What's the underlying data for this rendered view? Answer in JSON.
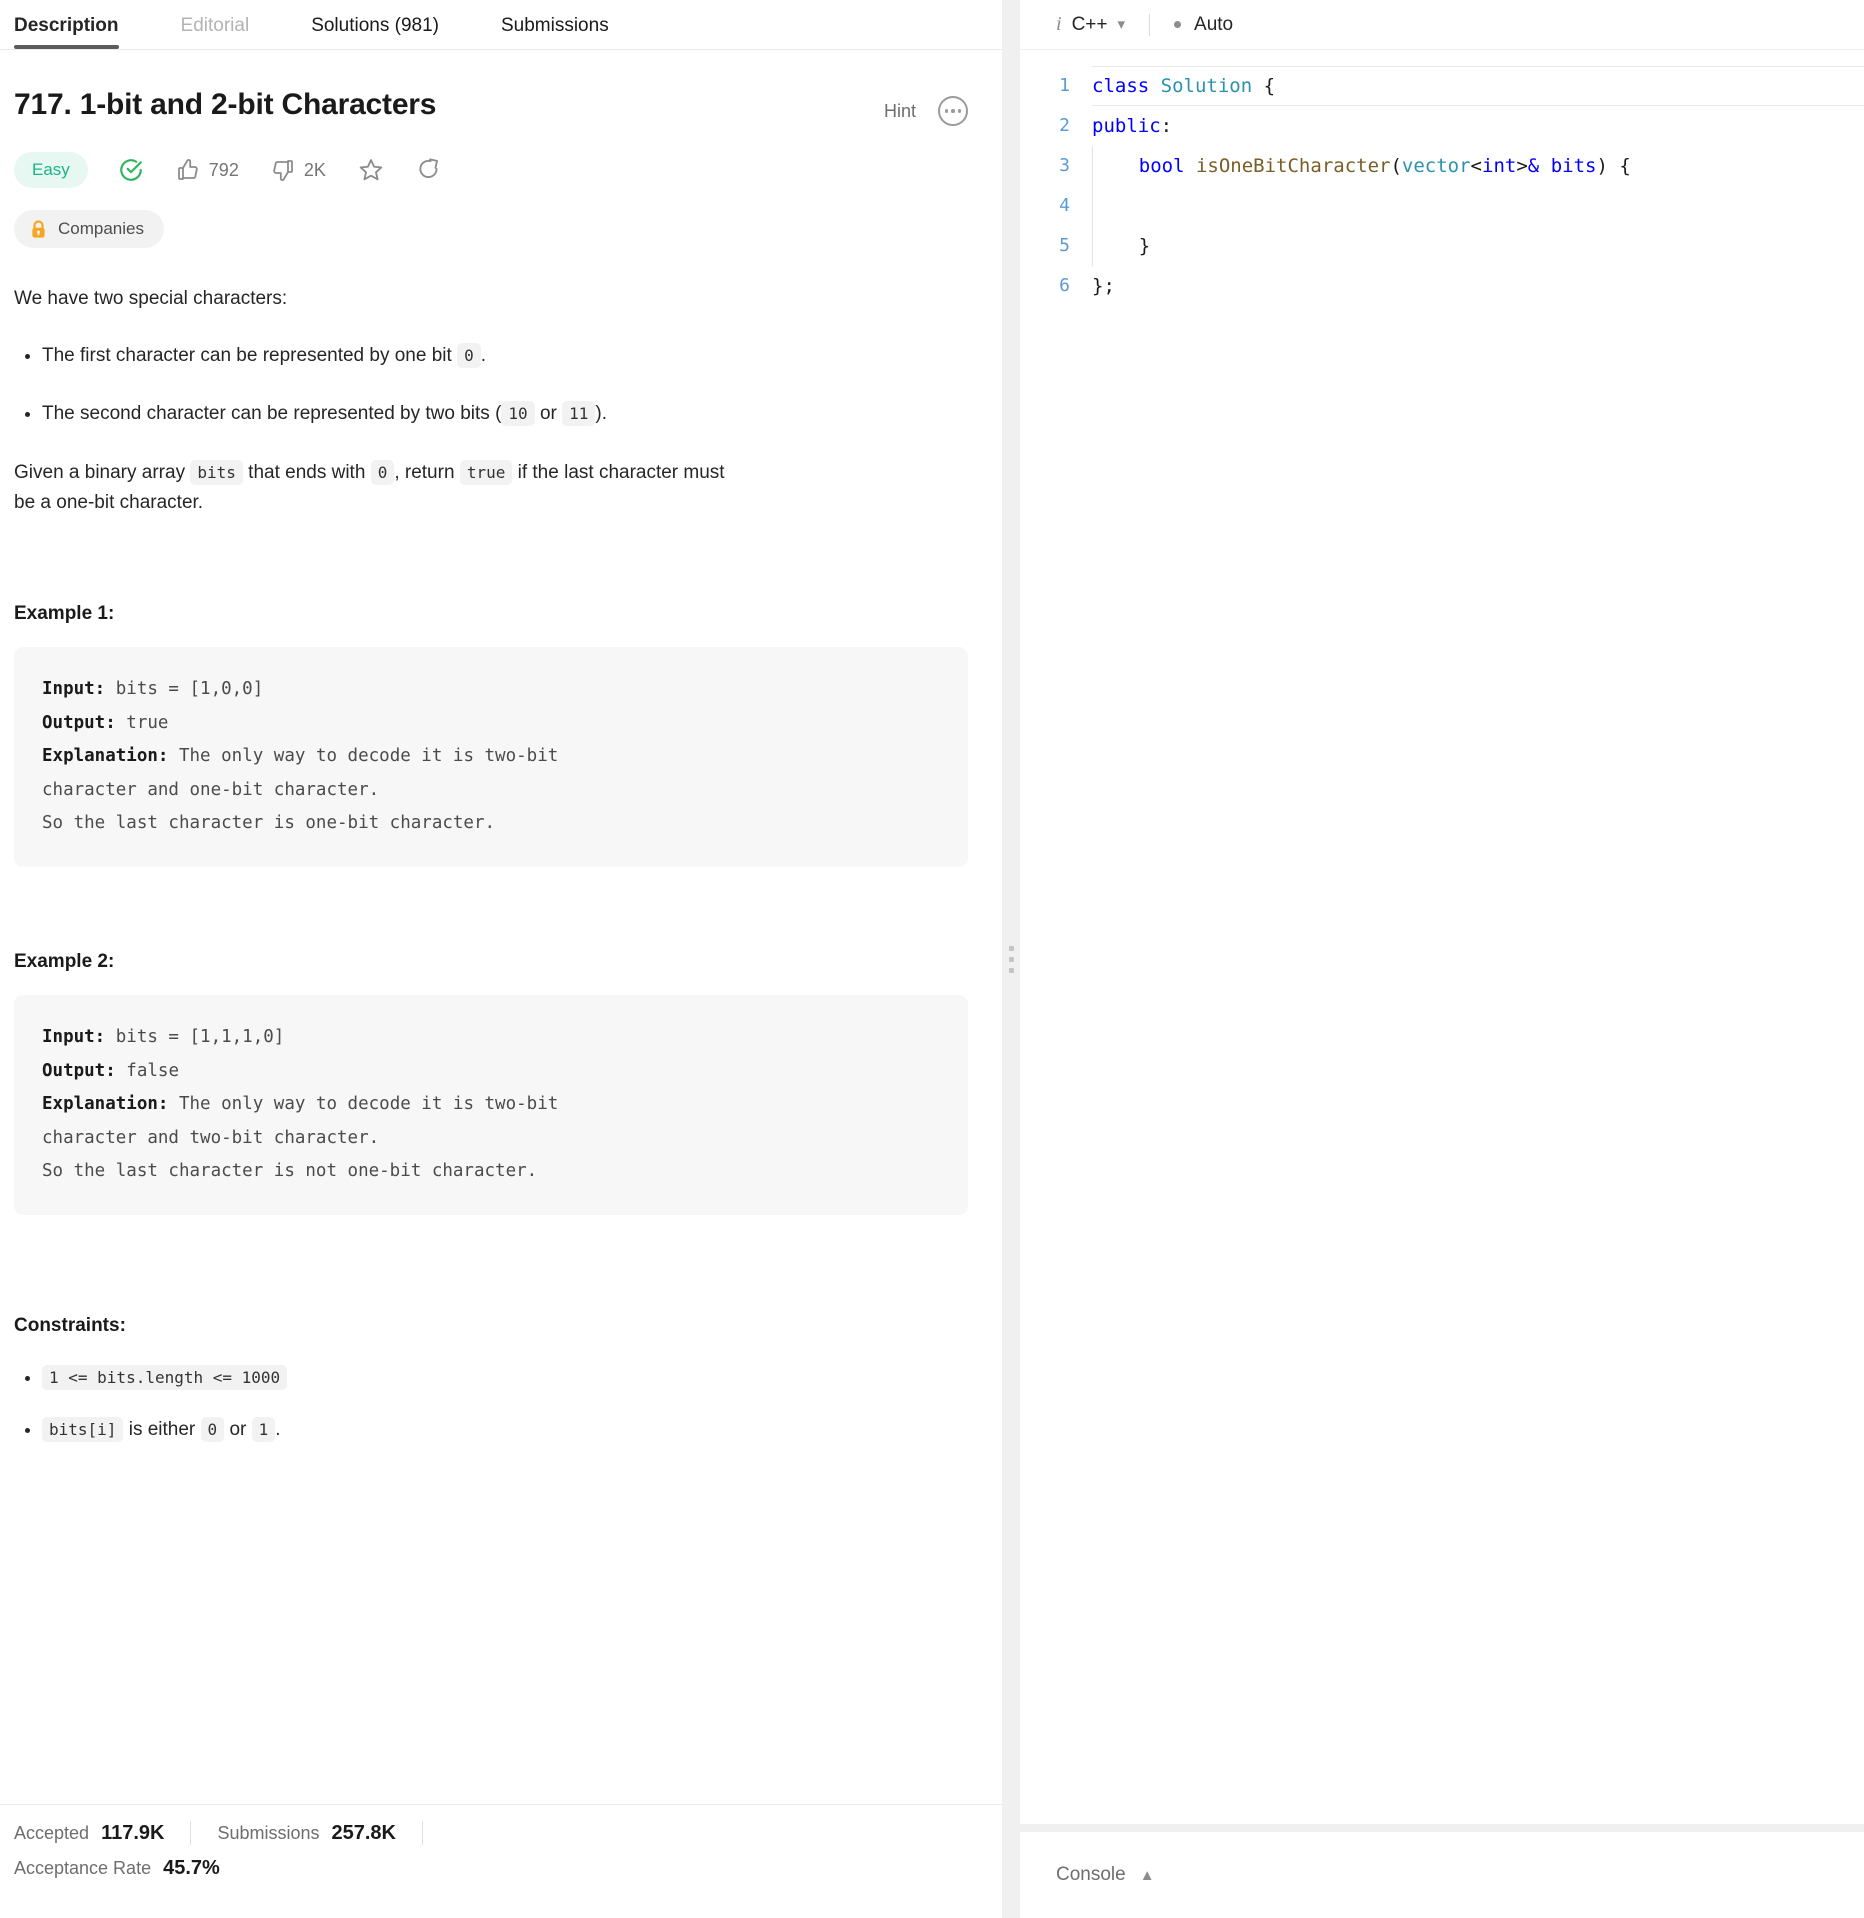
{
  "tabs": [
    {
      "label": "Description",
      "state": "active"
    },
    {
      "label": "Editorial",
      "state": "muted"
    },
    {
      "label": "Solutions (981)",
      "state": "normal"
    },
    {
      "label": "Submissions",
      "state": "normal"
    }
  ],
  "problem": {
    "title": "717. 1-bit and 2-bit Characters",
    "hint_label": "Hint",
    "difficulty": "Easy",
    "likes": "792",
    "dislikes": "2K",
    "companies_label": "Companies",
    "intro": "We have two special characters:",
    "bullets": [
      {
        "pre": "The first character can be represented by one bit ",
        "code": "0",
        "post": "."
      },
      {
        "pre": "The second character can be represented by two bits (",
        "code": "10",
        "mid": " or ",
        "code2": "11",
        "post": ")."
      }
    ],
    "statement": {
      "s1": "Given a binary array ",
      "c1": "bits",
      "s2": " that ends with ",
      "c2": "0",
      "s3": ", return ",
      "c3": "true",
      "s4": " if the last character must be a one-bit character."
    }
  },
  "examples": [
    {
      "heading": "Example 1:",
      "input_label": "Input:",
      "input_value": " bits = [1,0,0]",
      "output_label": "Output:",
      "output_value": " true",
      "explanation_label": "Explanation:",
      "explanation_value": " The only way to decode it is two-bit\ncharacter and one-bit character.\nSo the last character is one-bit character."
    },
    {
      "heading": "Example 2:",
      "input_label": "Input:",
      "input_value": " bits = [1,1,1,0]",
      "output_label": "Output:",
      "output_value": " false",
      "explanation_label": "Explanation:",
      "explanation_value": " The only way to decode it is two-bit\ncharacter and two-bit character.\nSo the last character is not one-bit character."
    }
  ],
  "constraints": {
    "heading": "Constraints:",
    "items": [
      {
        "code": "1 <= bits.length <= 1000",
        "text": "",
        "code2": "",
        "text2": "",
        "code3": "",
        "text3": ""
      },
      {
        "code": "bits[i]",
        "text": " is either ",
        "code2": "0",
        "text2": " or ",
        "code3": "1",
        "text3": "."
      }
    ]
  },
  "stats": {
    "accepted_label": "Accepted",
    "accepted_value": "117.9K",
    "submissions_label": "Submissions",
    "submissions_value": "257.8K",
    "rate_label": "Acceptance Rate",
    "rate_value": "45.7%"
  },
  "editor": {
    "language": "C++",
    "auto_label": "Auto",
    "lines": [
      {
        "n": "1",
        "html": "class Solution {"
      },
      {
        "n": "2",
        "html": "public:"
      },
      {
        "n": "3",
        "html": "    bool isOneBitCharacter(vector<int>& bits) {"
      },
      {
        "n": "4",
        "html": ""
      },
      {
        "n": "5",
        "html": "    }"
      },
      {
        "n": "6",
        "html": "};"
      }
    ]
  },
  "console": {
    "label": "Console"
  },
  "colors": {
    "easy": "#1cb489",
    "accent_blue": "#5b9bd5",
    "keyword": "#0000ff",
    "type": "#2b91af",
    "function": "#795e26",
    "lock": "#f5a623"
  }
}
